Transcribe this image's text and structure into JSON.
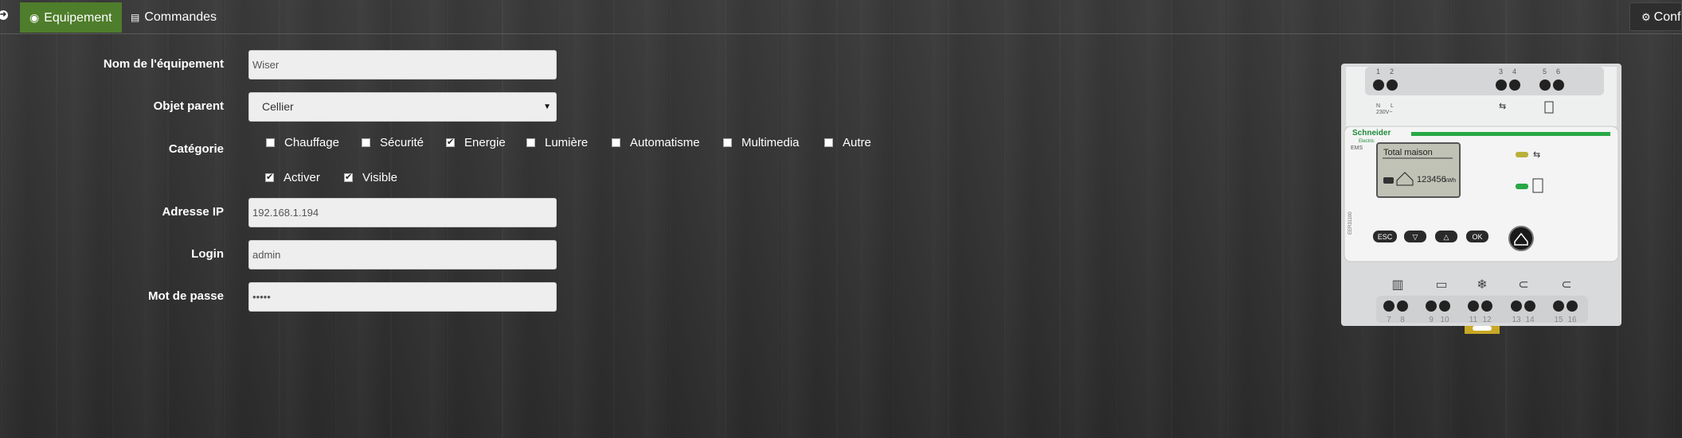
{
  "tabs": [
    {
      "label": "Equipement",
      "icon": "tachometer-icon",
      "active": true
    },
    {
      "label": "Commandes",
      "icon": "list-icon",
      "active": false
    }
  ],
  "config_label": "Configuration",
  "form": {
    "name_label": "Nom de l'équipement",
    "name_value": "Wiser",
    "parent_label": "Objet parent",
    "parent_value": "Cellier",
    "category_label": "Catégorie",
    "categories": [
      {
        "label": "Chauffage",
        "checked": false
      },
      {
        "label": "Sécurité",
        "checked": false
      },
      {
        "label": "Energie",
        "checked": true
      },
      {
        "label": "Lumière",
        "checked": false
      },
      {
        "label": "Automatisme",
        "checked": false
      },
      {
        "label": "Multimedia",
        "checked": false
      },
      {
        "label": "Autre",
        "checked": false
      }
    ],
    "options": [
      {
        "label": "Activer",
        "checked": true
      },
      {
        "label": "Visible",
        "checked": true
      }
    ],
    "ip_label": "Adresse IP",
    "ip_value": "192.168.1.194",
    "login_label": "Login",
    "login_value": "admin",
    "password_label": "Mot de passe",
    "password_value": "•••••"
  },
  "device": {
    "brand": "Schneider",
    "brand_sub": "Electric",
    "model": "EMS",
    "side_code": "EER31100",
    "top_terminals": [
      "1",
      "2",
      "3",
      "4",
      "5",
      "6"
    ],
    "top_labels": [
      "N",
      "L",
      "230V~"
    ],
    "screen_title": "Total maison",
    "screen_value": "123456",
    "screen_unit": "kWh",
    "buttons": [
      "ESC",
      "▽",
      "△",
      "OK"
    ],
    "bottom_terminals": [
      "7",
      "8",
      "9",
      "10",
      "11",
      "12",
      "13",
      "14",
      "15",
      "16"
    ]
  }
}
